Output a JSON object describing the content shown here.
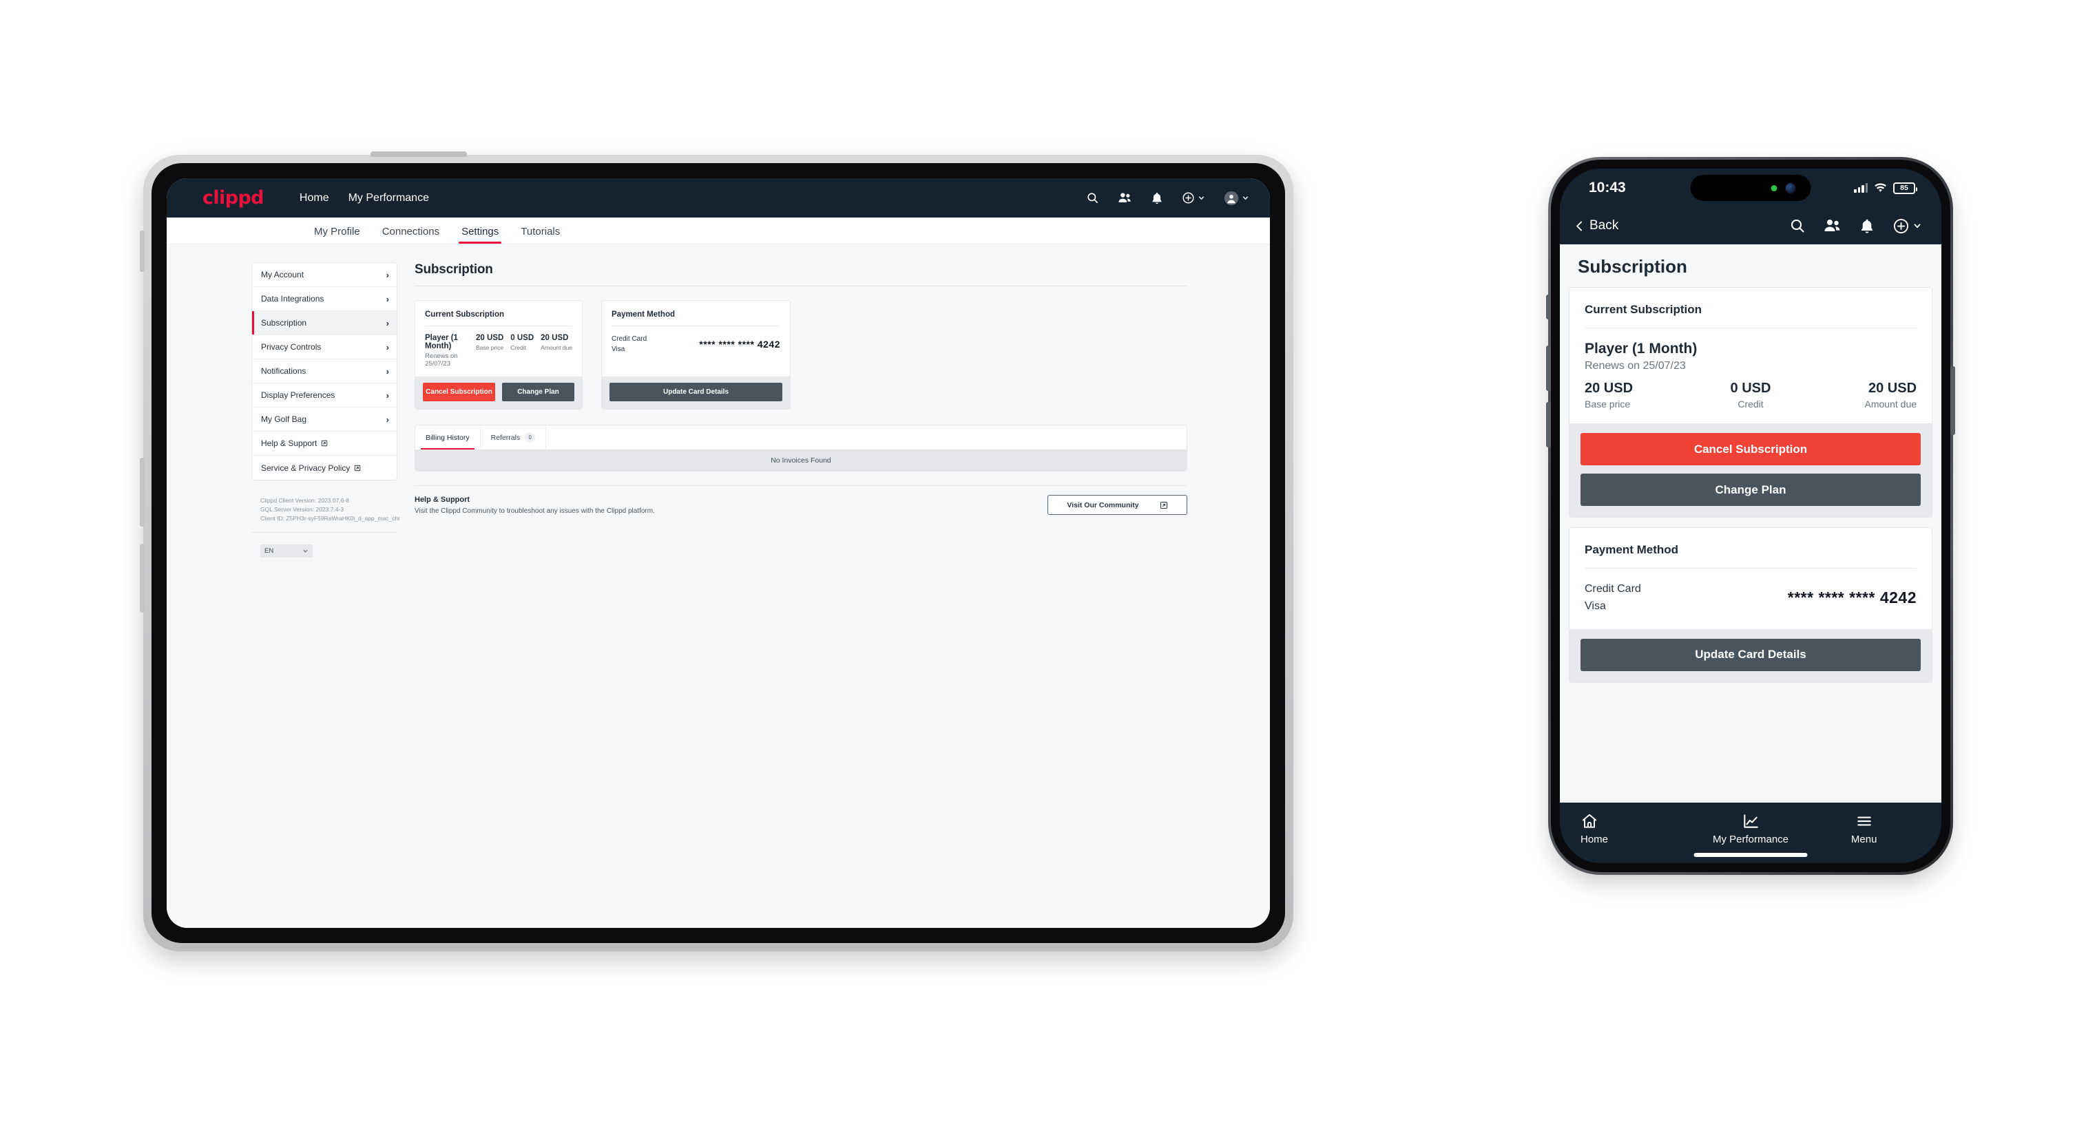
{
  "tablet": {
    "topnav": {
      "logo": "clippd",
      "links": [
        "Home",
        "My Performance"
      ],
      "icons": [
        "search-icon",
        "people-icon",
        "bell-icon",
        "plus-circle-icon",
        "avatar-icon"
      ]
    },
    "subtabs": [
      {
        "label": "My Profile",
        "active": false
      },
      {
        "label": "Connections",
        "active": false
      },
      {
        "label": "Settings",
        "active": true
      },
      {
        "label": "Tutorials",
        "active": false
      }
    ],
    "sidebar": {
      "items": [
        {
          "label": "My Account",
          "active": false,
          "external": false
        },
        {
          "label": "Data Integrations",
          "active": false,
          "external": false
        },
        {
          "label": "Subscription",
          "active": true,
          "external": false
        },
        {
          "label": "Privacy Controls",
          "active": false,
          "external": false
        },
        {
          "label": "Notifications",
          "active": false,
          "external": false
        },
        {
          "label": "Display Preferences",
          "active": false,
          "external": false
        },
        {
          "label": "My Golf Bag",
          "active": false,
          "external": false
        },
        {
          "label": "Help & Support",
          "active": false,
          "external": true
        },
        {
          "label": "Service & Privacy Policy",
          "active": false,
          "external": true
        }
      ],
      "version": {
        "client": "Clippd Client Version: 2023.07.6-8",
        "server": "GQL Server Version: 2023.7.4-3",
        "client_id": "Client ID: Z5PH3r-syF59RaWraHK0i_d_app_mac_chr"
      },
      "language": "EN"
    },
    "page_title": "Subscription",
    "subscription_card": {
      "header": "Current Subscription",
      "plan_name": "Player (1 Month)",
      "renews": "Renews on 25/07/23",
      "amounts": [
        {
          "value": "20 USD",
          "label": "Base price"
        },
        {
          "value": "0 USD",
          "label": "Credit"
        },
        {
          "value": "20 USD",
          "label": "Amount due"
        }
      ],
      "cancel_label": "Cancel Subscription",
      "change_label": "Change Plan"
    },
    "payment_card": {
      "header": "Payment Method",
      "type": "Credit Card",
      "brand": "Visa",
      "number": "**** **** **** 4242",
      "update_label": "Update Card Details"
    },
    "history": {
      "tabs": [
        {
          "label": "Billing History",
          "badge": null,
          "active": true
        },
        {
          "label": "Referrals",
          "badge": "0",
          "active": false
        }
      ],
      "empty": "No Invoices Found"
    },
    "help": {
      "title": "Help & Support",
      "description": "Visit the Clippd Community to troubleshoot any issues with the Clippd platform.",
      "button": "Visit Our Community"
    }
  },
  "phone": {
    "status": {
      "time": "10:43",
      "battery": "85"
    },
    "nav": {
      "back": "Back",
      "icons": [
        "search-icon",
        "people-icon",
        "bell-icon",
        "plus-circle-icon"
      ]
    },
    "page_title": "Subscription",
    "subscription_card": {
      "header": "Current Subscription",
      "plan_name": "Player (1 Month)",
      "renews": "Renews on 25/07/23",
      "amounts": [
        {
          "value": "20 USD",
          "label": "Base price"
        },
        {
          "value": "0 USD",
          "label": "Credit"
        },
        {
          "value": "20 USD",
          "label": "Amount due"
        }
      ],
      "cancel_label": "Cancel Subscription",
      "change_label": "Change Plan"
    },
    "payment_card": {
      "header": "Payment Method",
      "type": "Credit Card",
      "brand": "Visa",
      "number": "**** **** **** 4242",
      "update_label": "Update Card Details"
    },
    "tabbar": [
      {
        "label": "Home",
        "icon": "home-icon"
      },
      {
        "label": "My Performance",
        "icon": "chart-line-icon"
      },
      {
        "label": "Menu",
        "icon": "hamburger-icon"
      }
    ]
  },
  "colors": {
    "navy": "#152330",
    "brand_red": "#e8123c",
    "danger": "#ef4136",
    "dark_button": "#49545e",
    "page_bg": "#f7f8f9"
  }
}
